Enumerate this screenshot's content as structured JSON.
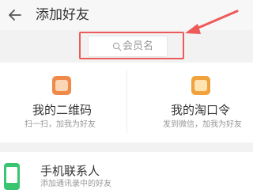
{
  "header": {
    "title": "添加好友",
    "back_icon": "back-arrow-icon"
  },
  "search": {
    "placeholder": "会员名",
    "icon": "search-icon"
  },
  "annotation": {
    "color": "#ee5a5a"
  },
  "cards": [
    {
      "title": "我的二维码",
      "subtitle": "扫一扫，加我为好友",
      "icon": "qr-code-icon",
      "icon_color": "#f08a4b"
    },
    {
      "title": "我的淘口令",
      "subtitle": "发到微信，加我为好友",
      "icon": "taokouling-icon",
      "icon_color": "#f0a23c"
    }
  ],
  "contacts": {
    "title": "手机联系人",
    "subtitle": "添加通讯录中的好友",
    "icon": "phone-icon",
    "icon_color": "#39c56f"
  }
}
